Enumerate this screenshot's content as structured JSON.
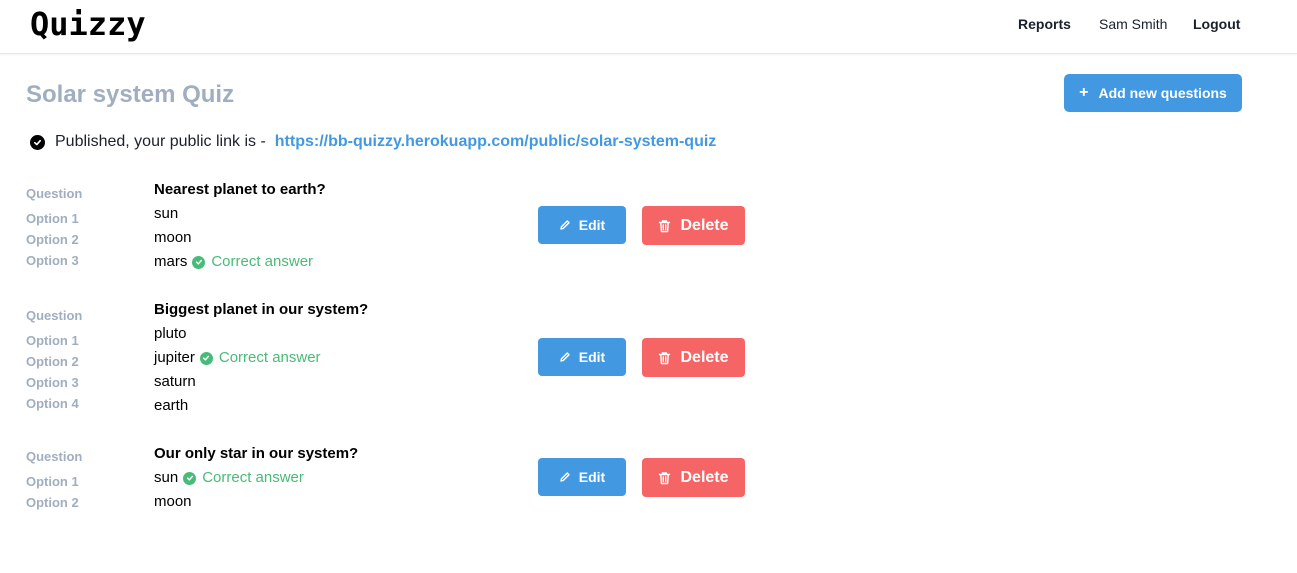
{
  "nav": {
    "logo": "Quizzy",
    "reports": "Reports",
    "user": "Sam Smith",
    "logout": "Logout"
  },
  "page": {
    "title": "Solar system Quiz",
    "add_button": "Add new questions",
    "published_text": "Published, your public link is -",
    "public_link": "https://bb-quizzy.herokuapp.com/public/solar-system-quiz"
  },
  "labels": {
    "question": "Question",
    "option_1": "Option 1",
    "option_2": "Option 2",
    "option_3": "Option 3",
    "option_4": "Option 4",
    "correct": "Correct answer",
    "edit": "Edit",
    "delete": "Delete"
  },
  "questions": [
    {
      "text": "Nearest planet to earth?",
      "options": [
        "sun",
        "moon",
        "mars"
      ],
      "correct_index": 2
    },
    {
      "text": "Biggest planet in our system?",
      "options": [
        "pluto",
        "jupiter",
        "saturn",
        "earth"
      ],
      "correct_index": 1
    },
    {
      "text": "Our only star in our system?",
      "options": [
        "sun",
        "moon"
      ],
      "correct_index": 0
    }
  ],
  "colors": {
    "accent": "#4299e1",
    "danger": "#f56565",
    "success": "#48bb78",
    "muted": "#a0aec0"
  }
}
